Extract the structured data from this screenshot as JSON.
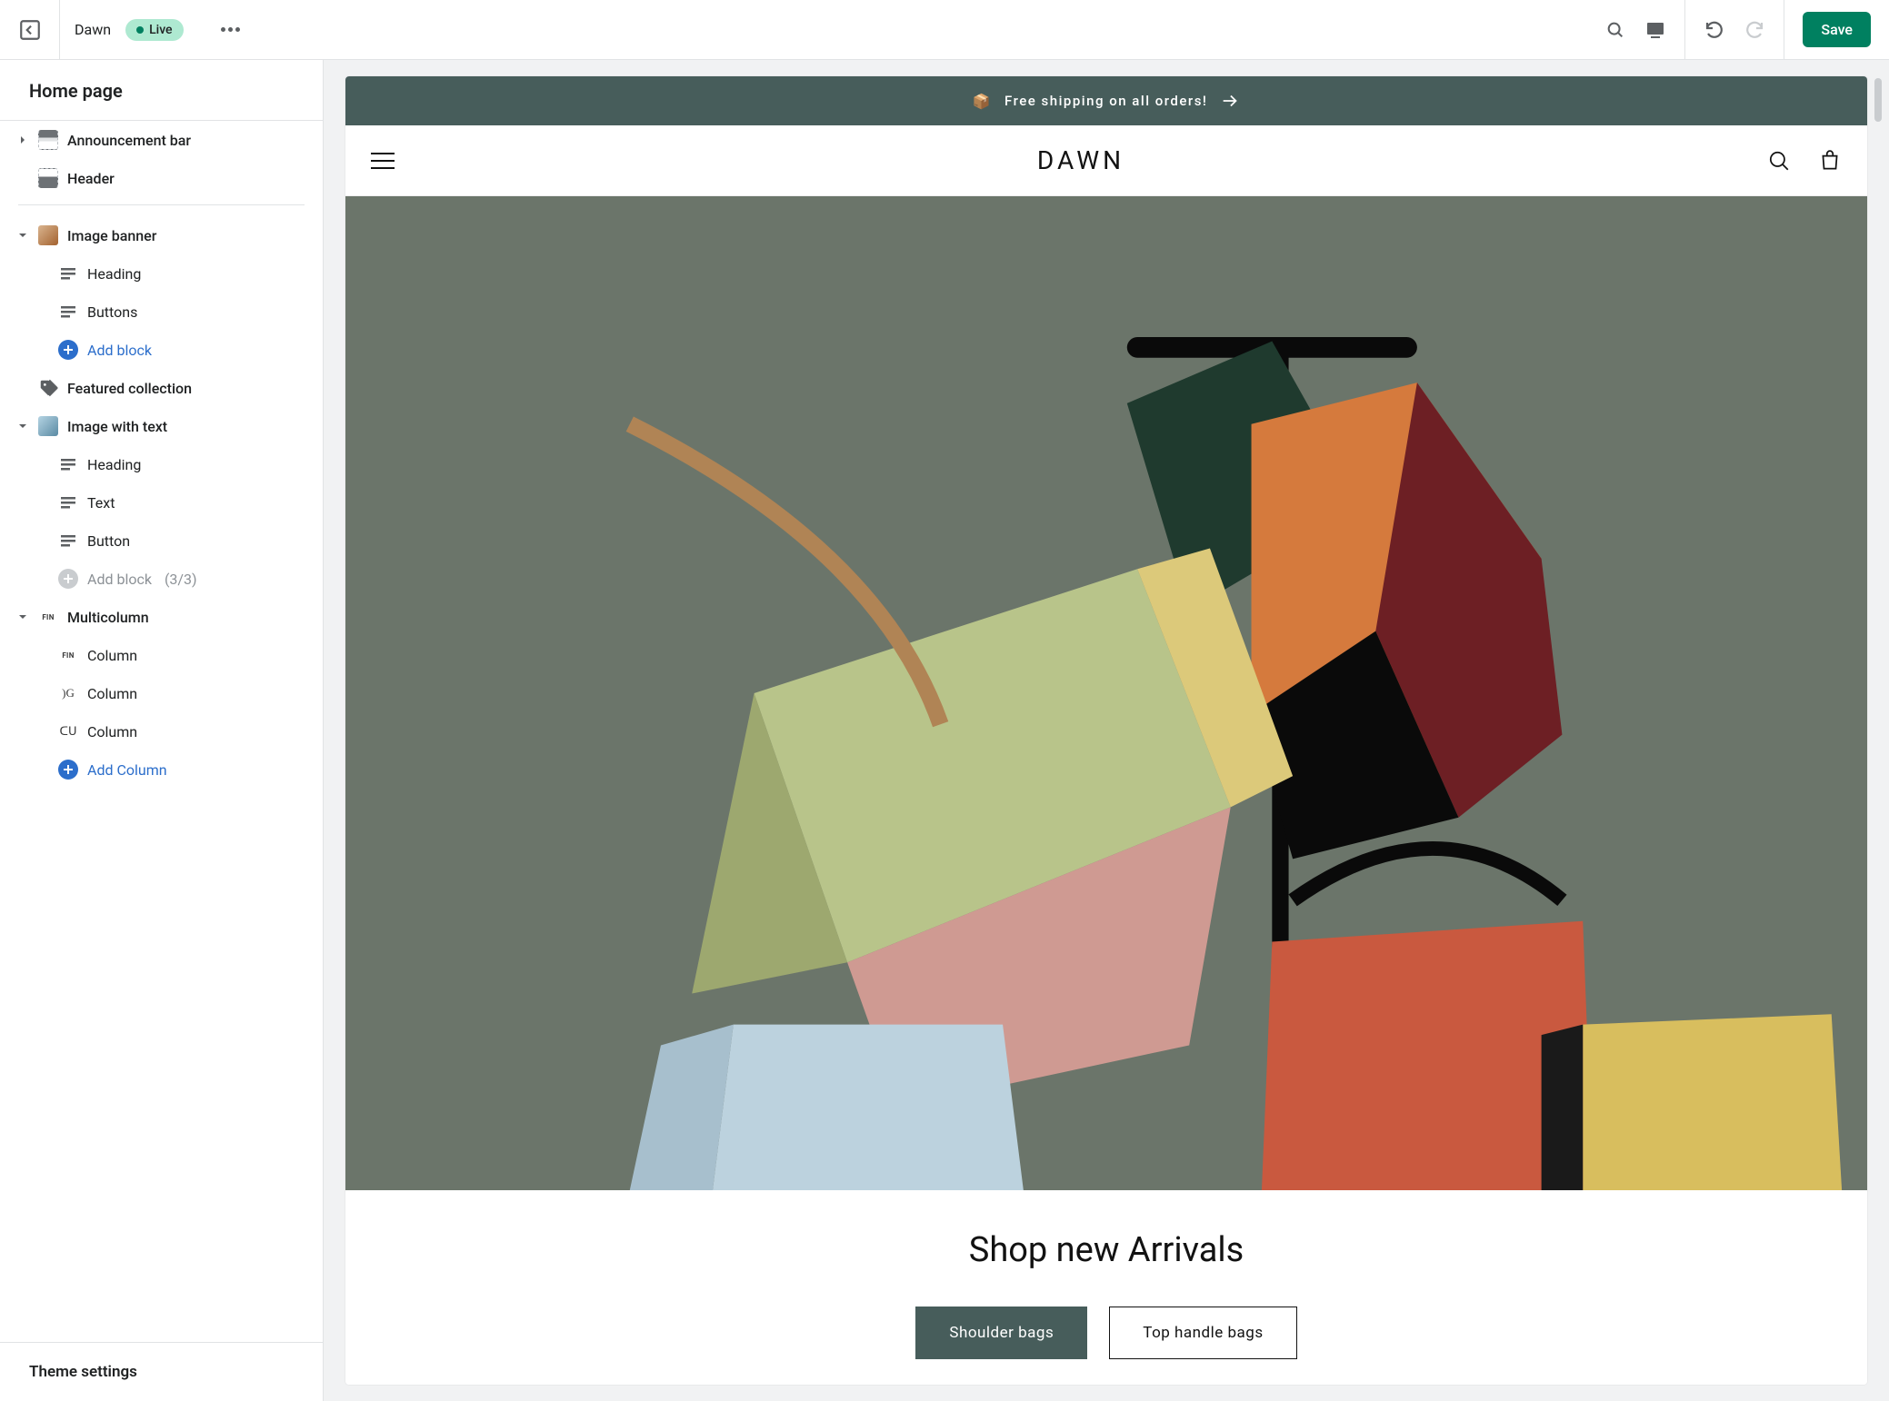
{
  "topbar": {
    "theme_name": "Dawn",
    "live_badge": "Live",
    "save_label": "Save"
  },
  "sidebar": {
    "title": "Home page",
    "footer": "Theme settings",
    "sections": {
      "announcement": "Announcement bar",
      "header": "Header",
      "image_banner": "Image banner",
      "image_banner_children": {
        "heading": "Heading",
        "buttons": "Buttons",
        "add_block": "Add block"
      },
      "featured_collection": "Featured collection",
      "image_with_text": "Image with text",
      "image_with_text_children": {
        "heading": "Heading",
        "text": "Text",
        "button": "Button",
        "add_block": "Add block",
        "add_block_count": "(3/3)"
      },
      "multicolumn": "Multicolumn",
      "multicolumn_children": {
        "column1": "Column",
        "column2": "Column",
        "column3": "Column",
        "add_column": "Add Column"
      }
    }
  },
  "preview": {
    "announcement_icon": "📦",
    "announcement_text": "Free shipping on all orders!",
    "logo": "DAWN",
    "banner": {
      "heading": "Shop new Arrivals",
      "btn1": "Shoulder bags",
      "btn2": "Top handle bags"
    }
  },
  "colors": {
    "accent": "#008060",
    "announcement_bg": "#475d5b",
    "link": "#2c6ecb"
  }
}
